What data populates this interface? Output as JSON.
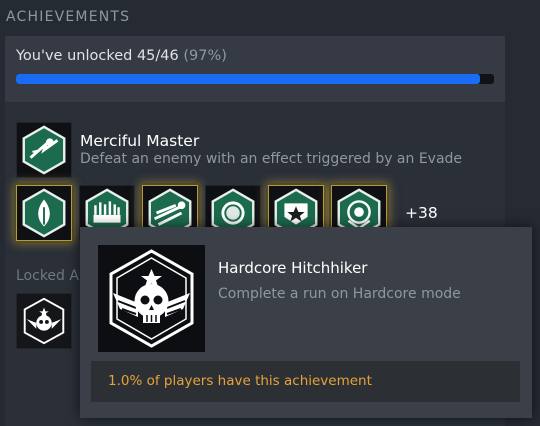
{
  "section": {
    "title": "ACHIEVEMENTS"
  },
  "progress": {
    "text": "You've unlocked 45/46",
    "percent_text": "(97%)",
    "fraction": 0.97
  },
  "recent": {
    "name": "Merciful Master",
    "description": "Defeat an enemy with an effect triggered by an Evade",
    "icon": "evade-slash-icon"
  },
  "unlocked_icons": [
    {
      "icon": "flame-leaf-icon"
    },
    {
      "icon": "crowd-hands-icon"
    },
    {
      "icon": "speed-slash-icon"
    },
    {
      "icon": "ring-orb-icon"
    },
    {
      "icon": "star-badge-icon"
    },
    {
      "icon": "target-shield-icon"
    }
  ],
  "more_count": "+38",
  "locked": {
    "label": "Locked A",
    "icon": "skull-wings-icon"
  },
  "tooltip": {
    "name": "Hardcore Hitchhiker",
    "description": "Complete a run on Hardcore mode",
    "rarity": "1.0% of players have this achievement",
    "icon": "skull-wings-icon"
  },
  "colors": {
    "accent_bar": "#1a6cf3",
    "rarity_text": "#e6a33c",
    "gold_glow": "#d8b03c",
    "icon_green": "#1c6b4e"
  }
}
